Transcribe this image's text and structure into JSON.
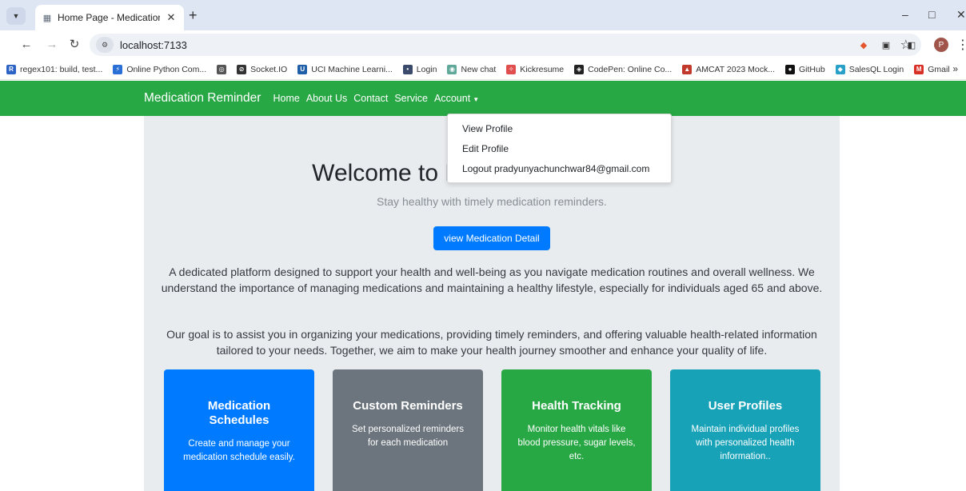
{
  "browser": {
    "tab_title": "Home Page - MedicationRemin",
    "url": "localhost:7133",
    "profile_initial": "P",
    "bookmarks": [
      {
        "label": "regex101: build, test...",
        "icon": "R",
        "color": "#2c63c4"
      },
      {
        "label": "Online Python Com...",
        "icon": "⚡",
        "color": "#2a6fd6"
      },
      {
        "label": "",
        "icon": "◎",
        "color": "#555555"
      },
      {
        "label": "Socket.IO",
        "icon": "⊘",
        "color": "#333333"
      },
      {
        "label": "UCI Machine Learni...",
        "icon": "U",
        "color": "#1f5fa8"
      },
      {
        "label": "Login",
        "icon": "•",
        "color": "#3a4a6b"
      },
      {
        "label": "New chat",
        "icon": "◉",
        "color": "#5fa89a"
      },
      {
        "label": "Kickresume",
        "icon": "✧",
        "color": "#e14e4e"
      },
      {
        "label": "CodePen: Online Co...",
        "icon": "◈",
        "color": "#222222"
      },
      {
        "label": "AMCAT 2023 Mock...",
        "icon": "▲",
        "color": "#c0392b"
      },
      {
        "label": "GitHub",
        "icon": "●",
        "color": "#111111"
      },
      {
        "label": "SalesQL Login",
        "icon": "◆",
        "color": "#28a0c8"
      },
      {
        "label": "Gmail",
        "icon": "M",
        "color": "#d93025"
      }
    ]
  },
  "navbar": {
    "brand": "Medication Reminder",
    "links": [
      "Home",
      "About Us",
      "Contact",
      "Service"
    ],
    "account": "Account",
    "color": "#28a745"
  },
  "dropdown": {
    "items": [
      "View Profile",
      "Edit Profile",
      "Logout pradyunyachunchwar84@gmail.com"
    ]
  },
  "hero": {
    "title": "Welcome to Medication Reminder",
    "subtitle": "Stay healthy with timely medication reminders.",
    "button": "view Medication Detail",
    "paragraph1": "A dedicated platform designed to support your health and well-being as you navigate medication routines and overall wellness. We understand the importance of managing medications and maintaining a healthy lifestyle, especially for individuals aged 65 and above.",
    "paragraph2": "Our goal is to assist you in organizing your medications, providing timely reminders, and offering valuable health-related information tailored to your needs. Together, we aim to make your health journey smoother and enhance your quality of life."
  },
  "cards": [
    {
      "title": "Medication Schedules",
      "text": "Create and manage your medication schedule easily.",
      "color": "#007bff"
    },
    {
      "title": "Custom Reminders",
      "text": "Set personalized reminders for each medication",
      "color": "#6c757d"
    },
    {
      "title": "Health Tracking",
      "text": "Monitor health vitals like blood pressure, sugar levels, etc.",
      "color": "#28a745"
    },
    {
      "title": "User Profiles",
      "text": "Maintain individual profiles with personalized health information..",
      "color": "#17a2b8"
    }
  ]
}
